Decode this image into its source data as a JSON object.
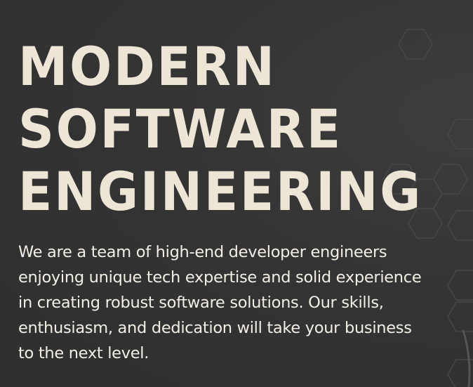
{
  "hero": {
    "headline": {
      "line1": "MODERN",
      "line2": "SOFTWARE",
      "line3": "ENGINEERING"
    },
    "description": {
      "line1": "We are a team of high-end developer engineers",
      "line2": "enjoying unique tech expertise and solid experience",
      "line3": "in creating robust software solutions. Our skills,",
      "line4": "enthusiasm, and dedication will take your business",
      "line5": "to the next level."
    }
  },
  "colors": {
    "background": "#333333",
    "headline": "#ede5d5",
    "body_text": "#f3efe7",
    "hex_outline": "#4a4a4a"
  },
  "icons": {
    "background_pattern": "hexagon-pattern"
  }
}
